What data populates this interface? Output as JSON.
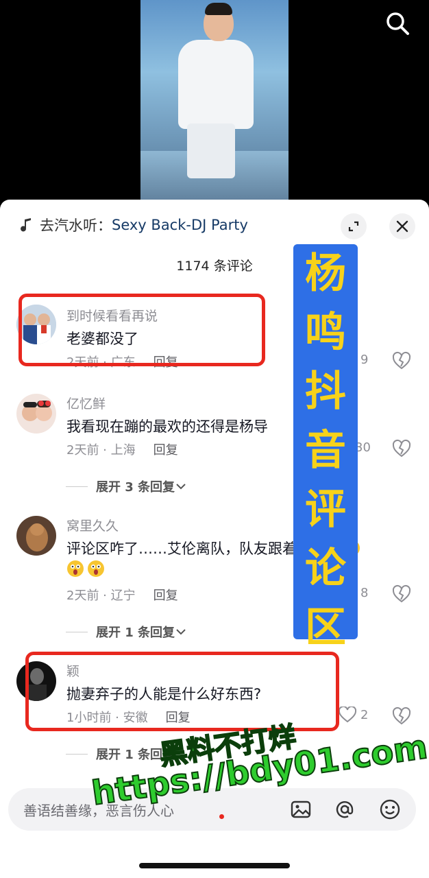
{
  "music": {
    "prefix": "去汽水听：",
    "song": "Sexy Back-DJ Party"
  },
  "header": {
    "count": "1174 条评论"
  },
  "overlay_text": [
    "杨",
    "鸣",
    "抖",
    "音",
    "评",
    "论",
    "区"
  ],
  "comments": [
    {
      "user": "到时候看看再说",
      "text": "老婆都没了",
      "time": "2天前 · 广东",
      "reply": "回复",
      "likes": "9"
    },
    {
      "user": "亿忆鲜",
      "text": "我看现在蹦的最欢的还得是杨导",
      "time": "2天前 · 上海",
      "reply": "回复",
      "likes": "30",
      "expand": "展开 3 条回复"
    },
    {
      "user": "窝里久久",
      "text": "评论区咋了……艾伦离队，队友跟着全挨骂",
      "time": "2天前 · 辽宁",
      "reply": "回复",
      "likes": "8",
      "expand": "展开 1 条回复"
    },
    {
      "user": "颖",
      "text": "抛妻弃子的人能是什么好东西?",
      "time": "1小时前 · 安徽",
      "reply": "回复",
      "likes": "2",
      "expand": "展开 1 条回复"
    }
  ],
  "input": {
    "placeholder": "善语结善缘，恶言伤人心"
  },
  "watermark": {
    "line1": "黑料不打烊",
    "line2": "https://bdy01.com"
  },
  "colors": {
    "accent": "#e8281f",
    "overlay_bg": "#2e6fe6",
    "overlay_text": "#f7d21a",
    "watermark": "#2ecc2e"
  },
  "icons": {
    "search": "search-icon",
    "music": "music-note-icon",
    "expand": "expand-icon",
    "close": "close-icon",
    "like": "heart-icon",
    "dislike": "broken-heart-icon",
    "image": "image-icon",
    "mention": "at-icon",
    "emoji": "emoji-icon"
  }
}
